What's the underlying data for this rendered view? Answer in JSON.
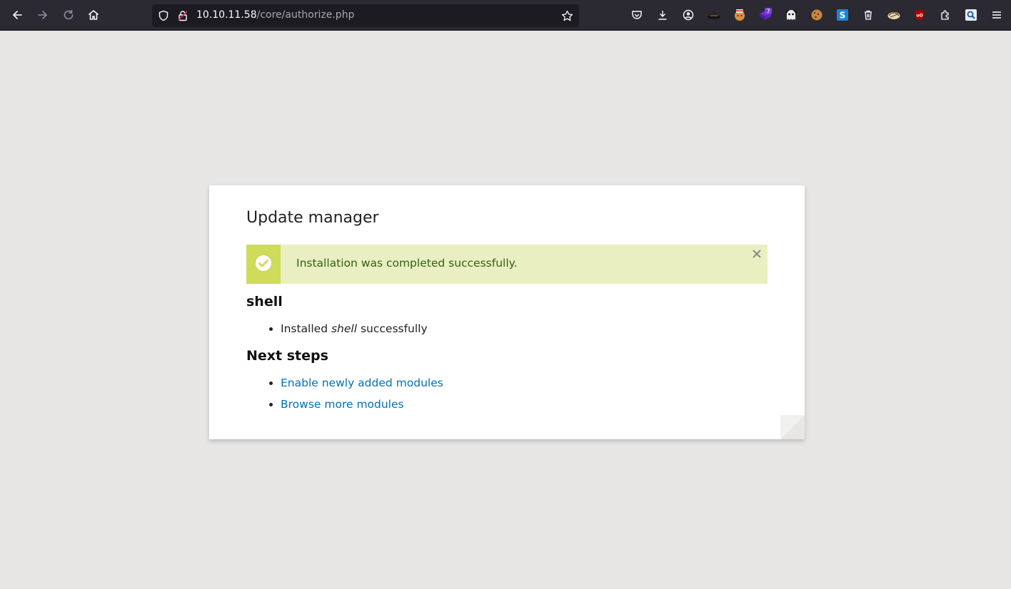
{
  "browser": {
    "url_host": "10.10.11.58",
    "url_path": "/core/authorize.php",
    "nav_buttons": [
      "back-icon",
      "forward-icon",
      "reload-icon",
      "home-icon"
    ],
    "extensions": [
      "pocket-icon",
      "downloads-icon",
      "account-icon",
      "hat-icon",
      "cookie-face-icon",
      "badge-7-icon",
      "ghost-icon",
      "cookie-icon",
      "s-square-icon",
      "trash-icon",
      "shell-icon",
      "ublock-icon",
      "extensions-icon",
      "search-ext-icon",
      "menu-icon"
    ],
    "extension_badge": "7"
  },
  "page": {
    "title": "Update manager",
    "message": {
      "text": "Installation was completed successfully.",
      "status": "success",
      "color_bg": "#e9efc0",
      "color_accent": "#cfdb5a",
      "color_text": "#325e1c"
    },
    "module_heading": "shell",
    "installed_items": [
      {
        "prefix": "Installed ",
        "name": "shell",
        "suffix": " successfully"
      }
    ],
    "next_steps_heading": "Next steps",
    "next_steps": [
      {
        "label": "Enable newly added modules"
      },
      {
        "label": "Browse more modules"
      }
    ],
    "link_color": "#0071b8"
  }
}
